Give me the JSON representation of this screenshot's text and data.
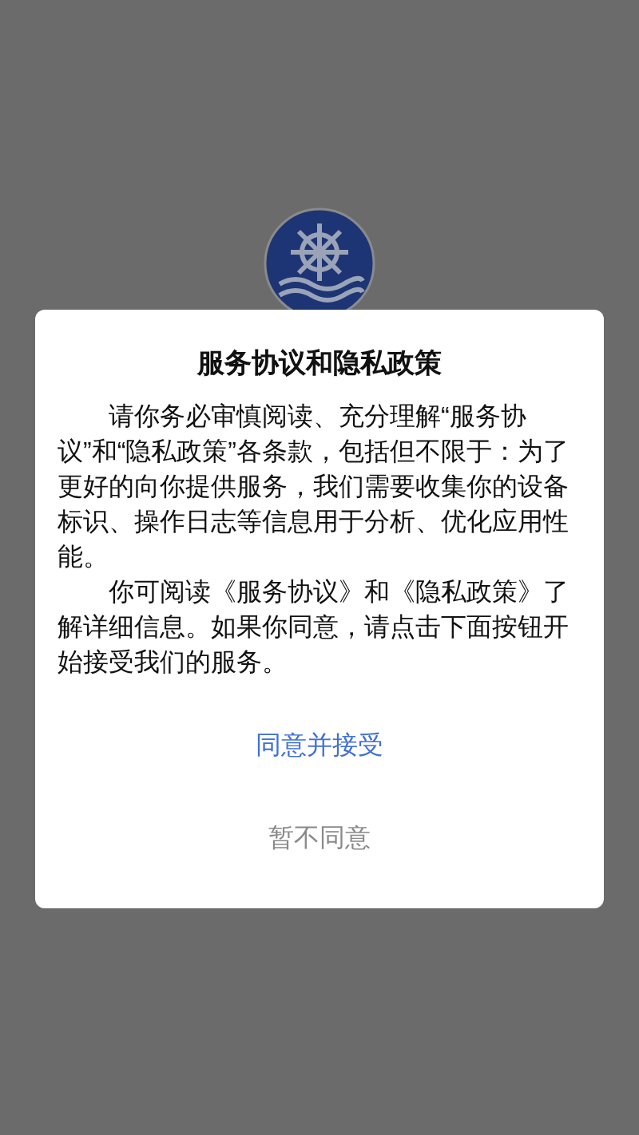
{
  "dialog": {
    "title": "服务协议和隐私政策",
    "paragraphs": [
      "请你务必审慎阅读、充分理解“服务协议”和“隐私政策”各条款，包括但不限于：为了更好的向你提供服务，我们需要收集你的设备标识、操作日志等信息用于分析、优化应用性能。",
      "你可阅读《服务协议》和《隐私政策》了解详细信息。如果你同意，请点击下面按钮开始接受我们的服务。"
    ],
    "buttons": [
      {
        "label": "同意并接受",
        "kind": "primary"
      },
      {
        "label": "暂不同意",
        "kind": "secondary"
      }
    ]
  }
}
